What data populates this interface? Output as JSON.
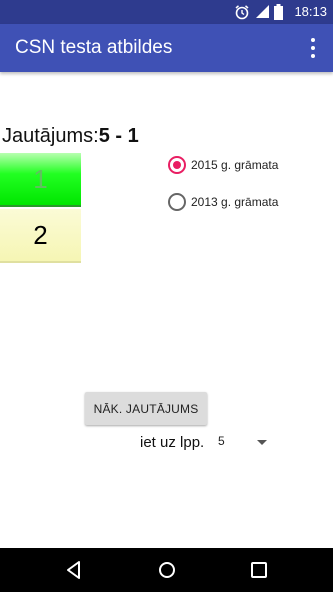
{
  "status_bar": {
    "time": "18:13",
    "icons": [
      "alarm-icon",
      "signal-icon",
      "battery-icon"
    ]
  },
  "app_bar": {
    "title": "CSN testa atbildes",
    "menu_icon": "overflow-menu-icon"
  },
  "question": {
    "label": "Jautājums:",
    "number": "5 - 1"
  },
  "answers": [
    {
      "label": "1",
      "state": "correct",
      "color": "#00e600"
    },
    {
      "label": "2",
      "state": "default",
      "color": "#f6f6b4"
    }
  ],
  "book_options": {
    "selected": "2015 g. grāmata",
    "items": [
      "2015 g. grāmata",
      "2013 g. grāmata"
    ]
  },
  "next_button": {
    "label": "NĀK. JAUTĀJUMS"
  },
  "goto_page": {
    "label": "iet uz lpp.",
    "value": "5"
  },
  "colors": {
    "app_bar": "#3f51b5",
    "status_bar": "#2e3b8e",
    "radio_accent": "#e91e63"
  },
  "nav_bar": {
    "icons": [
      "back-icon",
      "home-icon",
      "recents-icon"
    ]
  }
}
